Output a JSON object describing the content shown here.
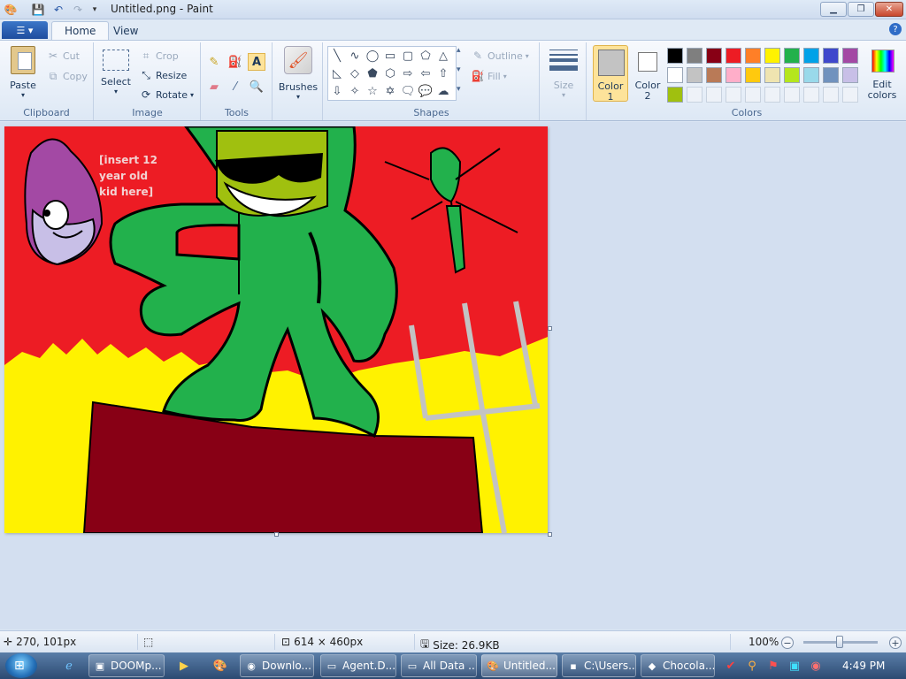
{
  "window": {
    "title": "Untitled.png - Paint"
  },
  "tabs": {
    "file_icon": "☰",
    "home": "Home",
    "view": "View",
    "help": "?"
  },
  "clipboard": {
    "paste": "Paste",
    "cut": "Cut",
    "copy": "Copy",
    "label": "Clipboard"
  },
  "image": {
    "select": "Select",
    "crop": "Crop",
    "resize": "Resize",
    "rotate": "Rotate",
    "label": "Image"
  },
  "tools": {
    "label": "Tools"
  },
  "brushes": {
    "label": "Brushes"
  },
  "shapes": {
    "outline": "Outline",
    "fill": "Fill",
    "label": "Shapes"
  },
  "size": {
    "label": "Size"
  },
  "colors": {
    "color1": "Color\n1",
    "color2": "Color\n2",
    "edit": "Edit\ncolors",
    "label": "Colors",
    "color1_value": "#c3c3c3",
    "color2_value": "#ffffff",
    "row1": [
      "#000000",
      "#7f7f7f",
      "#880015",
      "#ed1c24",
      "#ff7f27",
      "#fff200",
      "#22b14c",
      "#00a2e8",
      "#3f48cc",
      "#a349a4"
    ],
    "row2": [
      "#ffffff",
      "#c3c3c3",
      "#b97a57",
      "#ffaec9",
      "#ffc90e",
      "#efe4b0",
      "#b5e61d",
      "#99d9ea",
      "#7092be",
      "#c8bfe7"
    ],
    "row3": [
      "#a0c00f"
    ]
  },
  "canvas": {
    "text": "[insert 12\nyear old\nkid here]"
  },
  "status": {
    "cursor": "270, 101px",
    "selection": "",
    "dimensions": "614 × 460px",
    "size": "Size: 26.9KB",
    "zoom": "100%"
  },
  "taskbar": {
    "items": [
      {
        "label": "DOOMp..."
      },
      {
        "label": "Downlo..."
      },
      {
        "label": "Agent.D..."
      },
      {
        "label": "All Data ..."
      },
      {
        "label": "Untitled...."
      },
      {
        "label": "C:\\Users..."
      },
      {
        "label": "Chocola..."
      }
    ],
    "clock": "4:49 PM"
  }
}
